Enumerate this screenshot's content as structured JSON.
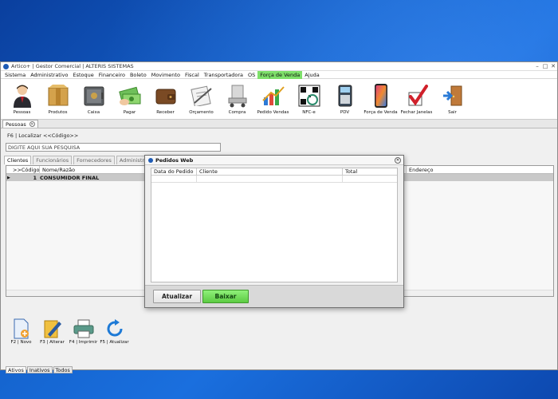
{
  "window": {
    "title": "Artico+ | Gestor Comercial | ALTERIS SISTEMAS",
    "minimize": "–",
    "maximize": "□",
    "close": "✕"
  },
  "menu": [
    "Sistema",
    "Administrativo",
    "Estoque",
    "Financeiro",
    "Boleto",
    "Movimento",
    "Fiscal",
    "Transportadora",
    "OS",
    "Força de Venda",
    "Ajuda"
  ],
  "menu_active": "Força de Venda",
  "toolbar": [
    {
      "label": "Pessoas",
      "icon": "person-icon"
    },
    {
      "label": "Produtos",
      "icon": "box-icon"
    },
    {
      "label": "Caixa",
      "icon": "safe-icon"
    },
    {
      "label": "Pagar",
      "icon": "money-icon"
    },
    {
      "label": "Receber",
      "icon": "wallet-icon"
    },
    {
      "label": "Orçamento",
      "icon": "clipboard-icon"
    },
    {
      "label": "Compra",
      "icon": "cart-icon"
    },
    {
      "label": "Pedido Vendas",
      "icon": "chart-icon"
    },
    {
      "label": "NFC-e",
      "icon": "qrcode-icon"
    },
    {
      "label": "PDV",
      "icon": "pos-terminal-icon"
    },
    {
      "label": "Força de Venda",
      "icon": "smartphone-icon"
    },
    {
      "label": "Fechar Janelas",
      "icon": "checkmark-icon"
    },
    {
      "label": "Sair",
      "icon": "exit-door-icon"
    }
  ],
  "doc_tab": {
    "label": "Pessoas",
    "close": "✕"
  },
  "locate_label": "F6 | Localizar <<Código>>",
  "search": {
    "value": "DIGITE AQUI SUA PESQUISA"
  },
  "sub_tabs": [
    "Clientes",
    "Funcionários",
    "Fornecedores",
    "Administradoras"
  ],
  "grid": {
    "columns": [
      ">>Código",
      "Nome/Razão",
      "Endereço"
    ],
    "rows": [
      {
        "indicator": "▶",
        "code": "1",
        "name": "CONSUMIDOR FINAL"
      }
    ]
  },
  "filter_tabs": [
    "Ativos",
    "Inativos",
    "Todos"
  ],
  "bottom_actions": [
    {
      "label": "F2 | Novo",
      "icon": "new-document-icon"
    },
    {
      "label": "F3 | Alterar",
      "icon": "edit-icon"
    },
    {
      "label": "F4 | Imprimir",
      "icon": "printer-icon"
    },
    {
      "label": "F5 | Atualizar",
      "icon": "refresh-icon"
    }
  ],
  "modal": {
    "title": "Pedidos Web",
    "close": "✕",
    "columns": [
      "Data do Pedido",
      "Cliente",
      "Total"
    ],
    "buttons": {
      "atualizar": "Atualizar",
      "baixar": "Baixar"
    }
  },
  "colors": {
    "menu_active": "#7ee06a",
    "baixar": "#5ccb43",
    "desktop": "#1565d0"
  }
}
